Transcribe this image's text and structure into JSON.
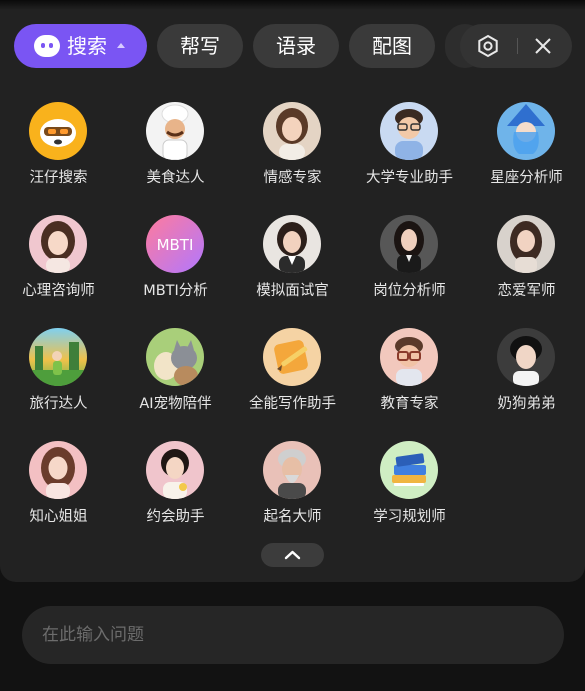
{
  "toolbar": {
    "search_label": "搜索",
    "help_label": "帮写",
    "quote_label": "语录",
    "image_label": "配图"
  },
  "colors": {
    "accent": "#7a55f3",
    "panel_background": "#222222",
    "pill_background": "#3a3a3a",
    "text": "#e6e6e6"
  },
  "agents": [
    {
      "label": "汪仔搜索",
      "icon": "wangzai-mascot-icon"
    },
    {
      "label": "美食达人",
      "icon": "chef-avatar"
    },
    {
      "label": "情感专家",
      "icon": "woman-avatar"
    },
    {
      "label": "大学专业助手",
      "icon": "student-avatar"
    },
    {
      "label": "星座分析师",
      "icon": "blue-witch-avatar"
    },
    {
      "label": "心理咨询师",
      "icon": "woman-avatar"
    },
    {
      "label": "MBTI分析",
      "icon": "mbti-gradient-icon",
      "badge": "MBTI"
    },
    {
      "label": "模拟面试官",
      "icon": "woman-avatar"
    },
    {
      "label": "岗位分析师",
      "icon": "woman-avatar"
    },
    {
      "label": "恋爱军师",
      "icon": "woman-avatar"
    },
    {
      "label": "旅行达人",
      "icon": "travel-landscape-avatar"
    },
    {
      "label": "AI宠物陪伴",
      "icon": "pets-avatar"
    },
    {
      "label": "全能写作助手",
      "icon": "pen-notepad-icon"
    },
    {
      "label": "教育专家",
      "icon": "teacher-glasses-avatar"
    },
    {
      "label": "奶狗弟弟",
      "icon": "young-man-avatar"
    },
    {
      "label": "知心姐姐",
      "icon": "woman-avatar"
    },
    {
      "label": "约会助手",
      "icon": "woman-avatar"
    },
    {
      "label": "起名大师",
      "icon": "old-man-avatar"
    },
    {
      "label": "学习规划师",
      "icon": "books-icon"
    }
  ],
  "input": {
    "placeholder": "在此输入问题"
  }
}
